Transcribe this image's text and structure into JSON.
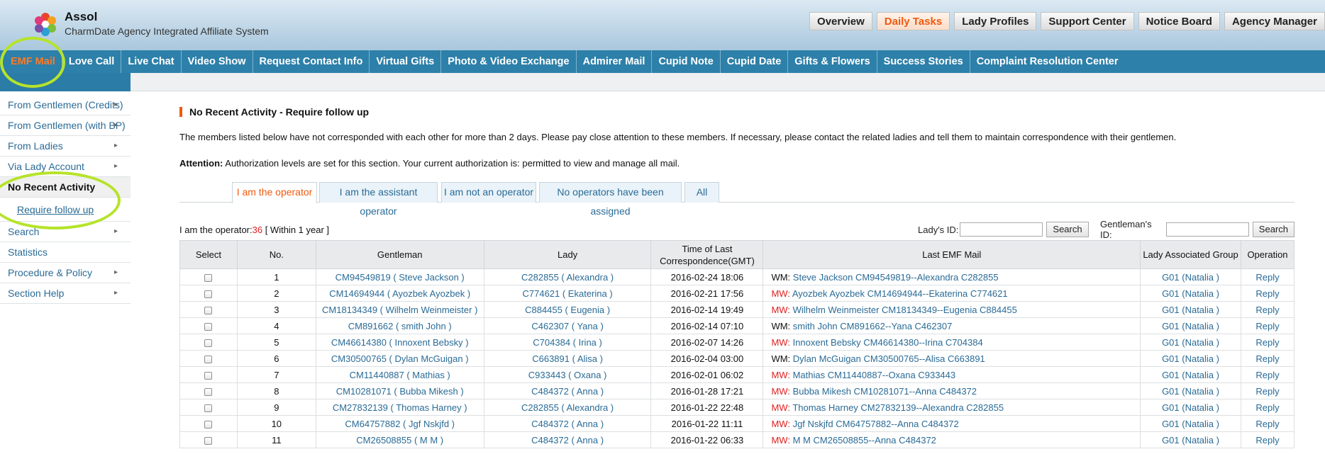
{
  "header": {
    "brand": "Assol",
    "tagline": "CharmDate Agency Integrated Affiliate System",
    "top_tabs": [
      "Overview",
      "Daily Tasks",
      "Lady Profiles",
      "Support Center",
      "Notice Board",
      "Agency Manager"
    ],
    "top_tabs_active": "Daily Tasks"
  },
  "main_nav": [
    "EMF Mail",
    "Love Call",
    "Live Chat",
    "Video Show",
    "Request Contact Info",
    "Virtual Gifts",
    "Photo & Video Exchange",
    "Admirer Mail",
    "Cupid Note",
    "Cupid Date",
    "Gifts & Flowers",
    "Success Stories",
    "Complaint Resolution Center"
  ],
  "main_nav_active": "EMF Mail",
  "sidebar": {
    "items": [
      {
        "label": "From Gentlemen (Credits)",
        "arrow": "▸"
      },
      {
        "label": "From Gentlemen (with BP)",
        "arrow": "▸"
      },
      {
        "label": "From Ladies",
        "arrow": "▸"
      },
      {
        "label": "Via Lady Account",
        "arrow": "▸"
      },
      {
        "label": "No Recent Activity",
        "arrow": ""
      },
      {
        "label": "Require follow up",
        "arrow": ""
      },
      {
        "label": "Search",
        "arrow": "▸"
      },
      {
        "label": "Statistics",
        "arrow": ""
      },
      {
        "label": "Procedure & Policy",
        "arrow": "▸"
      },
      {
        "label": "Section Help",
        "arrow": "▸"
      }
    ]
  },
  "page": {
    "title": "No Recent Activity - Require follow up",
    "description": "The members listed below have not corresponded with each other for more than 2 days. Please pay close attention to these members. If necessary, please contact the related ladies and tell them to maintain correspondence with their gentlemen.",
    "attention_label": "Attention:",
    "attention_text": " Authorization levels are set for this section. Your current authorization is: permitted to view and manage all mail."
  },
  "tabs": [
    "I am the operator",
    "I am the assistant operator",
    "I am not an operator",
    "No operators have been assigned",
    "All"
  ],
  "tabs_active": "I am the operator",
  "filter": {
    "label": "I am the operator:",
    "count": "36",
    "range": " [ Within 1 year ]",
    "lady_id_label": "Lady's ID:",
    "gentleman_id_label": "Gentleman's ID:",
    "search_label": "Search"
  },
  "table": {
    "columns": [
      "Select",
      "No.",
      "Gentleman",
      "Lady",
      "Time of Last Correspondence(GMT)",
      "Last EMF Mail",
      "Lady Associated Group",
      "Operation"
    ],
    "rows": [
      {
        "no": "1",
        "gentleman": "CM94549819 ( Steve Jackson )",
        "lady": "C282855 ( Alexandra )",
        "time": "2016-02-24 18:06",
        "type": "WM",
        "mail": "Steve Jackson CM94549819--Alexandra C282855",
        "group": "G01 (Natalia )",
        "op": "Reply"
      },
      {
        "no": "2",
        "gentleman": "CM14694944 ( Ayozbek Ayozbek )",
        "lady": "C774621 ( Ekaterina )",
        "time": "2016-02-21 17:56",
        "type": "MW",
        "mail": "Ayozbek Ayozbek CM14694944--Ekaterina C774621",
        "group": "G01 (Natalia )",
        "op": "Reply"
      },
      {
        "no": "3",
        "gentleman": "CM18134349 ( Wilhelm Weinmeister )",
        "lady": "C884455 ( Eugenia )",
        "time": "2016-02-14 19:49",
        "type": "MW",
        "mail": "Wilhelm Weinmeister CM18134349--Eugenia C884455",
        "group": "G01 (Natalia )",
        "op": "Reply"
      },
      {
        "no": "4",
        "gentleman": "CM891662 ( smith John )",
        "lady": "C462307 ( Yana )",
        "time": "2016-02-14 07:10",
        "type": "WM",
        "mail": "smith John CM891662--Yana C462307",
        "group": "G01 (Natalia )",
        "op": "Reply"
      },
      {
        "no": "5",
        "gentleman": "CM46614380 ( Innoxent Bebsky )",
        "lady": "C704384 ( Irina )",
        "time": "2016-02-07 14:26",
        "type": "MW",
        "mail": "Innoxent Bebsky CM46614380--Irina C704384",
        "group": "G01 (Natalia )",
        "op": "Reply"
      },
      {
        "no": "6",
        "gentleman": "CM30500765 ( Dylan McGuigan )",
        "lady": "C663891 ( Alisa )",
        "time": "2016-02-04 03:00",
        "type": "WM",
        "mail": "Dylan McGuigan CM30500765--Alisa C663891",
        "group": "G01 (Natalia )",
        "op": "Reply"
      },
      {
        "no": "7",
        "gentleman": "CM11440887 ( Mathias )",
        "lady": "C933443 ( Oxana )",
        "time": "2016-02-01 06:02",
        "type": "MW",
        "mail": "Mathias CM11440887--Oxana C933443",
        "group": "G01 (Natalia )",
        "op": "Reply"
      },
      {
        "no": "8",
        "gentleman": "CM10281071 ( Bubba Mikesh )",
        "lady": "C484372 ( Anna )",
        "time": "2016-01-28 17:21",
        "type": "MW",
        "mail": "Bubba Mikesh CM10281071--Anna C484372",
        "group": "G01 (Natalia )",
        "op": "Reply"
      },
      {
        "no": "9",
        "gentleman": "CM27832139 ( Thomas Harney )",
        "lady": "C282855 ( Alexandra )",
        "time": "2016-01-22 22:48",
        "type": "MW",
        "mail": "Thomas Harney CM27832139--Alexandra C282855",
        "group": "G01 (Natalia )",
        "op": "Reply"
      },
      {
        "no": "10",
        "gentleman": "CM64757882 ( Jgf Nskjfd )",
        "lady": "C484372 ( Anna )",
        "time": "2016-01-22 11:11",
        "type": "MW",
        "mail": "Jgf Nskjfd CM64757882--Anna C484372",
        "group": "G01 (Natalia )",
        "op": "Reply"
      },
      {
        "no": "11",
        "gentleman": "CM26508855 ( M M )",
        "lady": "C484372 ( Anna )",
        "time": "2016-01-22 06:33",
        "type": "MW",
        "mail": "M M CM26508855--Anna C484372",
        "group": "G01 (Natalia )",
        "op": "Reply"
      }
    ]
  },
  "colors": {
    "accent_orange": "#f0590f",
    "nav_blue": "#2d80a9",
    "link_blue": "#2a6b96",
    "mw_red": "#e02020",
    "highlight_green": "#b6e32a"
  }
}
